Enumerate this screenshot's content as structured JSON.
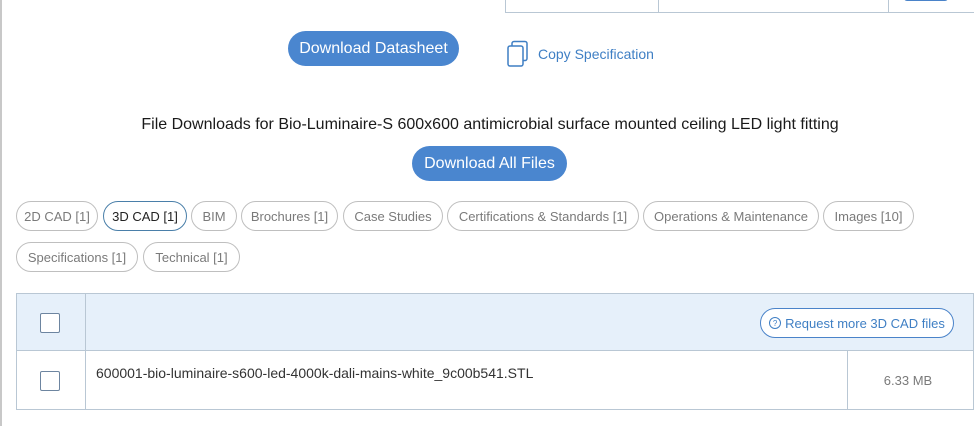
{
  "actions": {
    "download_datasheet": "Download Datasheet",
    "copy_specification": "Copy Specification"
  },
  "downloads": {
    "heading": "File Downloads for Bio-Luminaire-S 600x600 antimicrobial surface mounted ceiling LED light fitting",
    "download_all": "Download All Files"
  },
  "tabs": [
    {
      "label": "2D CAD [1]",
      "active": false
    },
    {
      "label": "3D CAD [1]",
      "active": true
    },
    {
      "label": "BIM",
      "active": false
    },
    {
      "label": "Brochures [1]",
      "active": false
    },
    {
      "label": "Case Studies",
      "active": false
    },
    {
      "label": "Certifications & Standards [1]",
      "active": false
    },
    {
      "label": "Operations & Maintenance",
      "active": false
    },
    {
      "label": "Images [10]",
      "active": false
    },
    {
      "label": "Specifications [1]",
      "active": false
    },
    {
      "label": "Technical [1]",
      "active": false
    }
  ],
  "table": {
    "request_more": "Request more 3D CAD files",
    "files": [
      {
        "name": "600001-bio-luminaire-s600-led-4000k-dali-mains-white_9c00b541.STL",
        "size": "6.33 MB"
      }
    ]
  },
  "colors": {
    "accent": "#4a86cf",
    "link": "#3f7fc4",
    "header_row": "#e6f0fa"
  }
}
